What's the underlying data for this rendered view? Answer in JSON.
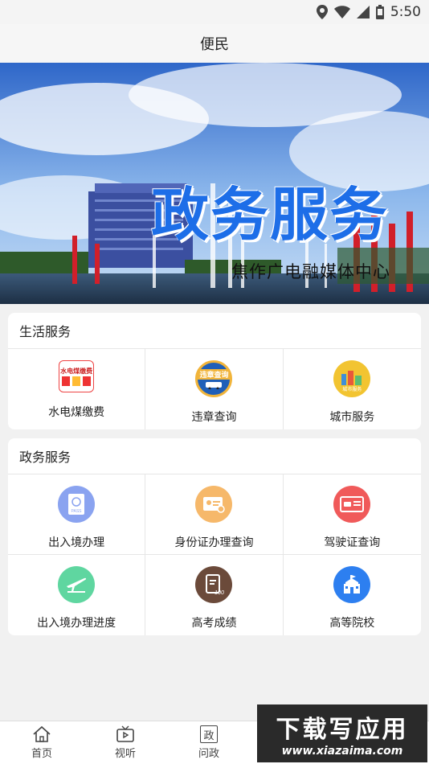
{
  "status": {
    "time": "5:50"
  },
  "header": {
    "title": "便民"
  },
  "banner": {
    "title": "政务服务",
    "subtitle": "焦作广电融媒体中心",
    "slides": 2,
    "active_slide": 1
  },
  "life_section": {
    "title": "生活服务",
    "items": [
      {
        "label": "水电煤缴费",
        "icon": "utility-bill-icon",
        "icon_text": "水电煤缴费"
      },
      {
        "label": "违章查询",
        "icon": "traffic-violation-icon",
        "icon_text": "违章查询"
      },
      {
        "label": "城市服务",
        "icon": "city-service-icon",
        "icon_text": "城市服务"
      }
    ]
  },
  "gov_section": {
    "title": "政务服务",
    "items": [
      {
        "label": "出入境办理",
        "icon": "passport-icon",
        "icon_text": "PASS"
      },
      {
        "label": "身份证办理查询",
        "icon": "id-card-icon"
      },
      {
        "label": "驾驶证查询",
        "icon": "driver-license-icon"
      },
      {
        "label": "出入境办理进度",
        "icon": "airplane-icon"
      },
      {
        "label": "高考成绩",
        "icon": "exam-score-icon",
        "icon_text": "100"
      },
      {
        "label": "高等院校",
        "icon": "university-icon"
      }
    ]
  },
  "tabbar": {
    "items": [
      {
        "label": "首页",
        "icon": "home-icon"
      },
      {
        "label": "视听",
        "icon": "tv-play-icon"
      },
      {
        "label": "问政",
        "icon": "gov-icon",
        "icon_text": "政"
      }
    ]
  },
  "watermark": {
    "main": "下载写应用",
    "url": "www.xiazaima.com"
  },
  "colors": {
    "accent_blue": "#1d6ee8",
    "passport": "#8aa3f0",
    "id_card": "#f6b86a",
    "license": "#f05a5a",
    "airplane": "#5fd6a0",
    "exam": "#6b4a3a",
    "university": "#2d7ff0"
  }
}
